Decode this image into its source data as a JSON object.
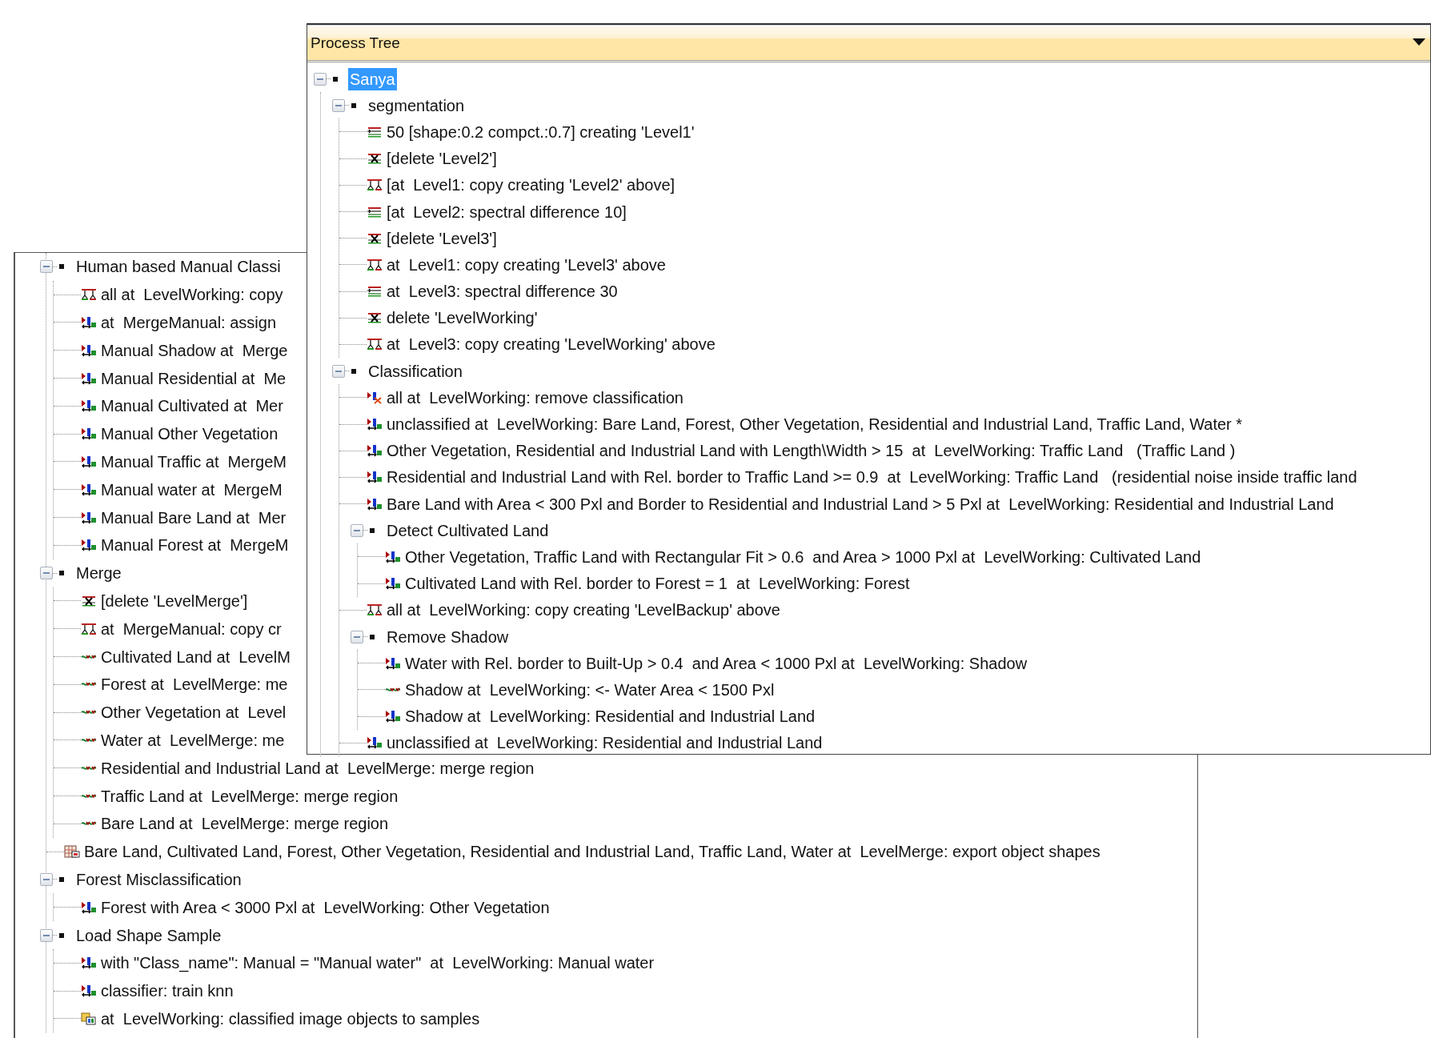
{
  "back_panel": {
    "items": [
      {
        "kind": "group",
        "label": "Human based Manual Classi",
        "expanded": true,
        "selected": false,
        "children": [
          {
            "kind": "copy",
            "label": "all at  LevelWorking: copy",
            "selected": false
          },
          {
            "kind": "classify",
            "label": "at  MergeManual: assign",
            "selected": false
          },
          {
            "kind": "classify",
            "label": "Manual Shadow at  Merge",
            "selected": false
          },
          {
            "kind": "classify",
            "label": "Manual Residential at  Me",
            "selected": false
          },
          {
            "kind": "classify",
            "label": "Manual Cultivated at  Mer",
            "selected": false
          },
          {
            "kind": "classify",
            "label": "Manual Other Vegetation",
            "selected": false
          },
          {
            "kind": "classify",
            "label": "Manual Traffic at  MergeM",
            "selected": false
          },
          {
            "kind": "classify",
            "label": "Manual water at  MergeM",
            "selected": false
          },
          {
            "kind": "classify",
            "label": "Manual Bare Land at  Mer",
            "selected": false
          },
          {
            "kind": "classify",
            "label": "Manual Forest at  MergeM",
            "selected": false
          }
        ]
      },
      {
        "kind": "group",
        "label": "Merge",
        "expanded": true,
        "selected": false,
        "children": [
          {
            "kind": "delete",
            "label": "[delete 'LevelMerge']",
            "selected": false
          },
          {
            "kind": "copy",
            "label": "at  MergeManual: copy cr",
            "selected": false
          },
          {
            "kind": "merge",
            "label": "Cultivated Land at  LevelM",
            "selected": false
          },
          {
            "kind": "merge",
            "label": "Forest at  LevelMerge: me",
            "selected": false
          },
          {
            "kind": "merge",
            "label": "Other Vegetation at  Level",
            "selected": false
          },
          {
            "kind": "merge",
            "label": "Water at  LevelMerge: me",
            "selected": false
          },
          {
            "kind": "merge",
            "label": "Residential and Industrial Land at  LevelMerge: merge region",
            "selected": false
          },
          {
            "kind": "merge",
            "label": "Traffic Land at  LevelMerge: merge region",
            "selected": false
          },
          {
            "kind": "merge",
            "label": "Bare Land at  LevelMerge: merge region",
            "selected": false
          }
        ]
      },
      {
        "kind": "export",
        "label": "Bare Land, Cultivated Land, Forest, Other Vegetation, Residential and Industrial Land, Traffic Land, Water at  LevelMerge: export object shapes",
        "selected": false
      },
      {
        "kind": "group",
        "label": "Forest Misclassification",
        "expanded": true,
        "selected": false,
        "children": [
          {
            "kind": "classify",
            "label": "Forest with Area < 3000 Pxl at  LevelWorking: Other Vegetation",
            "selected": false
          }
        ]
      },
      {
        "kind": "group",
        "label": "Load Shape Sample",
        "expanded": true,
        "selected": false,
        "children": [
          {
            "kind": "classify",
            "label": "with \"Class_name\": Manual = \"Manual water\"  at  LevelWorking: Manual water",
            "selected": false
          },
          {
            "kind": "classify",
            "label": "classifier: train knn",
            "selected": false
          },
          {
            "kind": "sample",
            "label": "at  LevelWorking: classified image objects to samples",
            "selected": false
          }
        ]
      }
    ]
  },
  "process_tree": {
    "title": "Process Tree",
    "items": [
      {
        "kind": "group",
        "label": "Sanya",
        "expanded": true,
        "selected": true,
        "children": [
          {
            "kind": "group",
            "label": "segmentation",
            "expanded": true,
            "selected": false,
            "children": [
              {
                "kind": "segment",
                "label": "50 [shape:0.2 compct.:0.7] creating 'Level1'",
                "selected": false
              },
              {
                "kind": "delete",
                "label": "[delete 'Level2']",
                "selected": false
              },
              {
                "kind": "copy",
                "label": "[at  Level1: copy creating 'Level2' above]",
                "selected": false
              },
              {
                "kind": "segment",
                "label": "[at  Level2: spectral difference 10]",
                "selected": false
              },
              {
                "kind": "delete",
                "label": "[delete 'Level3']",
                "selected": false
              },
              {
                "kind": "copy",
                "label": "at  Level1: copy creating 'Level3' above",
                "selected": false
              },
              {
                "kind": "segment",
                "label": "at  Level3: spectral difference 30",
                "selected": false
              },
              {
                "kind": "delete",
                "label": "delete 'LevelWorking'",
                "selected": false
              },
              {
                "kind": "copy",
                "label": "at  Level3: copy creating 'LevelWorking' above",
                "selected": false
              }
            ]
          },
          {
            "kind": "group",
            "label": "Classification",
            "expanded": true,
            "selected": false,
            "children": [
              {
                "kind": "unclassify",
                "label": "all at  LevelWorking: remove classification",
                "selected": false
              },
              {
                "kind": "classify",
                "label": "unclassified at  LevelWorking: Bare Land, Forest, Other Vegetation, Residential and Industrial Land, Traffic Land, Water *",
                "selected": false
              },
              {
                "kind": "classify",
                "label": "Other Vegetation, Residential and Industrial Land with Length\\Width > 15  at  LevelWorking: Traffic Land   (Traffic Land )",
                "selected": false
              },
              {
                "kind": "classify",
                "label": "Residential and Industrial Land with Rel. border to Traffic Land >= 0.9  at  LevelWorking: Traffic Land   (residential noise inside traffic land",
                "selected": false
              },
              {
                "kind": "classify",
                "label": "Bare Land with Area < 300 Pxl and Border to Residential and Industrial Land > 5 Pxl at  LevelWorking: Residential and Industrial Land",
                "selected": false
              },
              {
                "kind": "group",
                "label": "Detect Cultivated Land",
                "expanded": true,
                "selected": false,
                "children": [
                  {
                    "kind": "classify",
                    "label": "Other Vegetation, Traffic Land with Rectangular Fit > 0.6  and Area > 1000 Pxl at  LevelWorking: Cultivated Land",
                    "selected": false
                  },
                  {
                    "kind": "classify",
                    "label": "Cultivated Land with Rel. border to Forest = 1  at  LevelWorking: Forest",
                    "selected": false
                  }
                ]
              },
              {
                "kind": "copy",
                "label": "all at  LevelWorking: copy creating 'LevelBackup' above",
                "selected": false
              },
              {
                "kind": "group",
                "label": "Remove Shadow",
                "expanded": true,
                "selected": false,
                "children": [
                  {
                    "kind": "classify",
                    "label": "Water with Rel. border to Built-Up > 0.4  and Area < 1000 Pxl at  LevelWorking: Shadow",
                    "selected": false
                  },
                  {
                    "kind": "merge",
                    "label": "Shadow at  LevelWorking: <- Water Area < 1500 Pxl",
                    "selected": false
                  },
                  {
                    "kind": "classify",
                    "label": "Shadow at  LevelWorking: Residential and Industrial Land",
                    "selected": false
                  }
                ]
              },
              {
                "kind": "classify",
                "label": "unclassified at  LevelWorking: Residential and Industrial Land",
                "selected": false
              }
            ]
          }
        ]
      }
    ]
  }
}
